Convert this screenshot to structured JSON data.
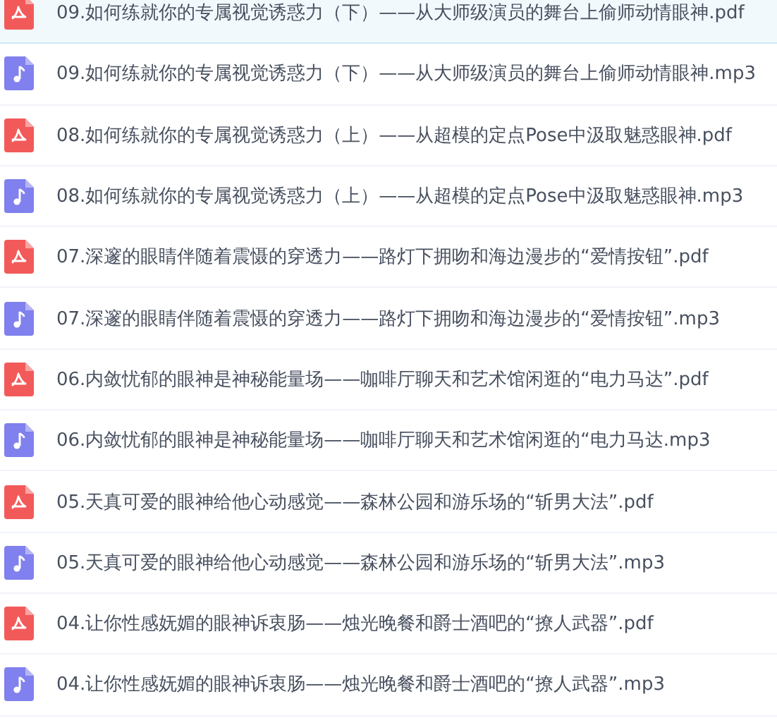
{
  "files": [
    {
      "kind": "pdf",
      "name": "09.如何练就你的专属视觉诱惑力（下）——从大师级演员的舞台上偷师动情眼神.pdf",
      "selected": true
    },
    {
      "kind": "mp3",
      "name": "09.如何练就你的专属视觉诱惑力（下）——从大师级演员的舞台上偷师动情眼神.mp3",
      "selected": false
    },
    {
      "kind": "pdf",
      "name": "08.如何练就你的专属视觉诱惑力（上）——从超模的定点Pose中汲取魅惑眼神.pdf",
      "selected": false
    },
    {
      "kind": "mp3",
      "name": "08.如何练就你的专属视觉诱惑力（上）——从超模的定点Pose中汲取魅惑眼神.mp3",
      "selected": false
    },
    {
      "kind": "pdf",
      "name": "07.深邃的眼睛伴随着震慑的穿透力——路灯下拥吻和海边漫步的“爱情按钮”.pdf",
      "selected": false
    },
    {
      "kind": "mp3",
      "name": "07.深邃的眼睛伴随着震慑的穿透力——路灯下拥吻和海边漫步的“爱情按钮”.mp3",
      "selected": false
    },
    {
      "kind": "pdf",
      "name": "06.内敛忧郁的眼神是神秘能量场——咖啡厅聊天和艺术馆闲逛的“电力马达”.pdf",
      "selected": false
    },
    {
      "kind": "mp3",
      "name": "06.内敛忧郁的眼神是神秘能量场——咖啡厅聊天和艺术馆闲逛的“电力马达.mp3",
      "selected": false
    },
    {
      "kind": "pdf",
      "name": "05.天真可爱的眼神给他心动感觉——森林公园和游乐场的“斩男大法”.pdf",
      "selected": false
    },
    {
      "kind": "mp3",
      "name": "05.天真可爱的眼神给他心动感觉——森林公园和游乐场的“斩男大法”.mp3",
      "selected": false
    },
    {
      "kind": "pdf",
      "name": "04.让你性感妩媚的眼神诉衷肠——烛光晚餐和爵士酒吧的“撩人武器”.pdf",
      "selected": false
    },
    {
      "kind": "mp3",
      "name": "04.让你性感妩媚的眼神诉衷肠——烛光晚餐和爵士酒吧的“撩人武器”.mp3",
      "selected": false
    }
  ]
}
